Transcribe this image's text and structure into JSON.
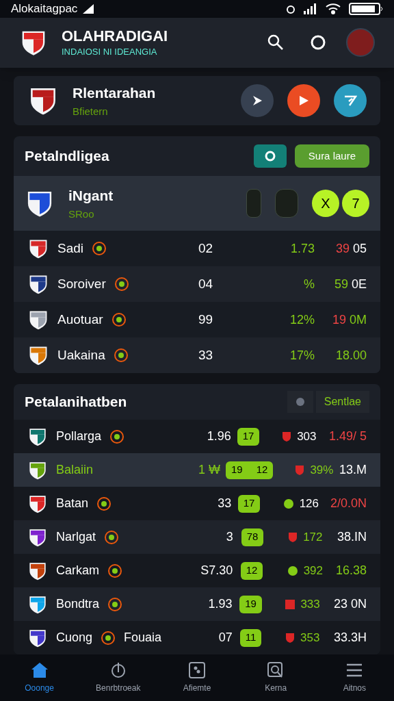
{
  "status_bar": {
    "carrier": "Alokaitagpac"
  },
  "header": {
    "title": "OLAHRADIGAI",
    "subtitle": "INDAIOSI NI IDEANGIA"
  },
  "match_card": {
    "team": "Rlentarahan",
    "status": "Bfietern"
  },
  "section_1": {
    "title": "Petalndligea",
    "action": "Sura laure",
    "highlight": {
      "team": "iNgant",
      "sub": "SRoo",
      "badges": [
        {
          "text": "X"
        },
        {
          "text": "7"
        }
      ]
    },
    "rows": [
      {
        "name": "Sadi",
        "color": "#d62828",
        "value": "02",
        "pct": "1.73",
        "score": [
          {
            "text": "39",
            "color": "#ef4444"
          },
          {
            "text": "05",
            "color": "#ffffff"
          }
        ]
      },
      {
        "name": "Soroiver",
        "color": "#1e3a8a",
        "value": "04",
        "pct": "%",
        "score": [
          {
            "text": "59",
            "color": "#84cc16"
          },
          {
            "text": "0E",
            "color": "#ffffff"
          }
        ]
      },
      {
        "name": "Auotuar",
        "color": "#9ca3af",
        "value": "99",
        "pct": "12%",
        "score": [
          {
            "text": "19",
            "color": "#ef4444"
          },
          {
            "text": "0M",
            "color": "#84cc16"
          }
        ]
      },
      {
        "name": "Uakaina",
        "color": "#d97706",
        "value": "33",
        "pct": "17%",
        "score": [
          {
            "text": "18.00",
            "color": "#84cc16"
          }
        ]
      }
    ]
  },
  "section_2": {
    "title": "Petalanihatben",
    "action": "Sentlae",
    "rows": [
      {
        "name": "Pollarga",
        "color": "#0f766e",
        "selected": false,
        "value": "1.96",
        "pills": [
          "17"
        ],
        "stat": {
          "kind": "shield",
          "text": "303",
          "color": "#ffffff"
        },
        "last": {
          "text": "1.49/ 5",
          "color": "#ef4444"
        }
      },
      {
        "name": "Balaiin",
        "color": "#65a30d",
        "selected": true,
        "value": "1 ₩",
        "pills": [
          "19",
          "12"
        ],
        "stat": {
          "kind": "shield",
          "text": "39%",
          "color": "#84cc16"
        },
        "last": {
          "text": "13.M",
          "color": "#ffffff"
        }
      },
      {
        "name": "Batan",
        "color": "#dc2626",
        "selected": false,
        "value": "33",
        "pills": [
          "17"
        ],
        "stat": {
          "kind": "dot",
          "text": "126",
          "color": "#ffffff"
        },
        "last": {
          "text": "2/0.0N",
          "color": "#ef4444"
        }
      },
      {
        "name": "Narlgat",
        "color": "#7e22ce",
        "selected": false,
        "value": "3",
        "pills": [
          "78"
        ],
        "stat": {
          "kind": "shield",
          "text": "172",
          "color": "#84cc16"
        },
        "last": {
          "text": "38.IN",
          "color": "#ffffff"
        }
      },
      {
        "name": "Carkam",
        "color": "#c2410c",
        "selected": false,
        "value": "S7.30",
        "pills": [
          "12"
        ],
        "stat": {
          "kind": "dot",
          "text": "392",
          "color": "#84cc16"
        },
        "last": {
          "text": "16.38",
          "color": "#84cc16"
        }
      },
      {
        "name": "Bondtra",
        "color": "#0ea5e9",
        "selected": false,
        "value": "1.93",
        "pills": [
          "19"
        ],
        "stat": {
          "kind": "square",
          "text": "333",
          "color": "#84cc16"
        },
        "last": {
          "text": "23 0N",
          "color": "#ffffff"
        }
      },
      {
        "name": "Cuong",
        "extra": "Fouaia",
        "color": "#4338ca",
        "selected": false,
        "value": "07",
        "pills": [
          "11"
        ],
        "stat": {
          "kind": "shield",
          "text": "353",
          "color": "#84cc16"
        },
        "last": {
          "text": "33.3H",
          "color": "#ffffff"
        }
      }
    ]
  },
  "bottom_nav": [
    {
      "label": "Ooonge",
      "selected": true
    },
    {
      "label": "Benrbtroeak",
      "selected": false
    },
    {
      "label": "Afiemte",
      "selected": false
    },
    {
      "label": "Kerna",
      "selected": false
    },
    {
      "label": "Aitnos",
      "selected": false
    }
  ]
}
